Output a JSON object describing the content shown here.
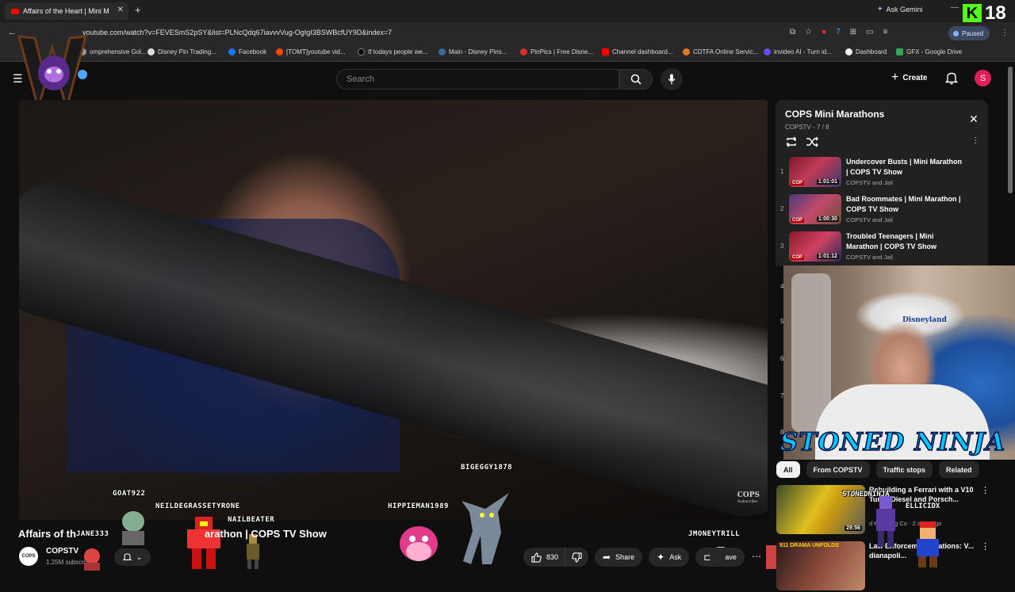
{
  "browser": {
    "tab_title": "Affairs of the Heart | Mini M",
    "ask_gemini": "Ask Gemini",
    "kick_count": "18",
    "url": "youtube.com/watch?v=FEVESmS2pSY&list=PLNcQdq67iavvvVug-OgIgI3BSWBcfUY9D&index=7",
    "profile_status": "Paused",
    "bookmarks": [
      {
        "label": "omprehensive Gol...",
        "color": "#9a9a9a"
      },
      {
        "label": "Disney Pin Trading...",
        "color": "#dddddd"
      },
      {
        "label": "Facebook",
        "color": "#1877f2"
      },
      {
        "label": "[TOMT]youtube vid...",
        "color": "#ff4500"
      },
      {
        "label": "If todays people we...",
        "color": "#000000"
      },
      {
        "label": "Main - Disney Pins...",
        "color": "#3a6a9a"
      },
      {
        "label": "PinPics | Free Disne...",
        "color": "#d22e2e"
      },
      {
        "label": "Channel dashboard...",
        "color": "#ff0000"
      },
      {
        "label": "CDTFA Online Servic...",
        "color": "#e07a20"
      },
      {
        "label": "invideo AI - Turn id...",
        "color": "#6a4cf0"
      },
      {
        "label": "Dashboard",
        "color": "#eeeeee"
      },
      {
        "label": "GFX - Google Drive",
        "color": "#34a853"
      }
    ]
  },
  "header": {
    "search_placeholder": "Search",
    "create_label": "Create",
    "avatar_letter": "S"
  },
  "video": {
    "watermark": "COPS",
    "watermark_sub": "Subscribe",
    "title_left": "Affairs of th",
    "title_right": "arathon | COPS TV Show",
    "channel_name": "COPSTV",
    "channel_avatar": "COPS",
    "subscribers": "1.25M subscri",
    "like_count": "830",
    "share_label": "Share",
    "ask_label": "Ask",
    "save_label": "ave"
  },
  "chat_overlay": {
    "names": [
      "GOAT922",
      "NEILDEGRASSETYRONE",
      "NAILBEATER",
      "JANE333",
      "BIGEGGY1878",
      "HIPPIEMAN1989",
      "JMONEYTRILL"
    ]
  },
  "playlist": {
    "title": "COPS Mini Marathons",
    "subtitle": "COPSTV - 7 / 8",
    "items": [
      {
        "index": "1",
        "title": "Undercover Busts | Mini Marathon | COPS TV Show",
        "channel": "COPSTV and Jail",
        "duration": "1:01:01"
      },
      {
        "index": "2",
        "title": "Bad Roommates | Mini Marathon | COPS TV Show",
        "channel": "COPSTV and Jail",
        "duration": "1:00:30"
      },
      {
        "index": "3",
        "title": "Troubled Teenagers | Mini Marathon | COPS TV Show",
        "channel": "COPSTV and Jail",
        "duration": "1:01:12"
      }
    ],
    "hidden_indexes": [
      "4",
      "5",
      "6",
      "7",
      "8"
    ]
  },
  "streamer": {
    "cap_text": "Disneyland",
    "banner": "STONED NINJA",
    "tag": "STONEDNINJA",
    "tag2": "ELLICIDX"
  },
  "recommendations": {
    "chips": [
      "All",
      "From COPSTV",
      "Traffic stops",
      "Related"
    ],
    "items": [
      {
        "title": "Rebuilding a Ferrari with a V10 Turbo Diesel and Porsch...",
        "meta1": "d Pranding Co",
        "meta2": "2 days ago",
        "duration": "29:56"
      },
      {
        "title": "Law Enforcement ... ations: V... dianapoli...",
        "meta1": "",
        "meta2": "",
        "thumb_text": "911 DRAMA UNFOLDS"
      }
    ]
  }
}
